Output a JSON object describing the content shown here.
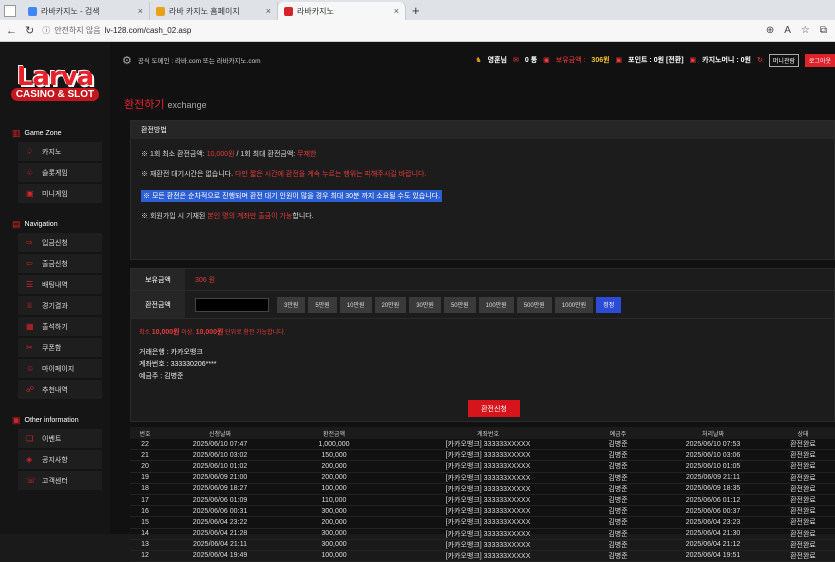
{
  "browser": {
    "tabs": [
      {
        "label": "라바카지노 - 검색",
        "fav": "#4285f4"
      },
      {
        "label": "라바 카지노 홈페이지",
        "fav": "#e8a21a"
      },
      {
        "label": "라바카지노",
        "fav": "#d9232a"
      }
    ],
    "security": "안전하지 않음",
    "url": "lv-128.com/cash_02.asp"
  },
  "site": {
    "logo_main": "Larva",
    "logo_sub": "CASINO & SLOT",
    "domain_note": "공식 도메인 : 라바.com 또는 라바카지노.com",
    "user": "영훈님",
    "msg_count": "0 통",
    "balance_label": "보유금액 :",
    "balance": "306원",
    "points": "포인트 : 0원 [전환]",
    "casino_money": "카지노머니 : 0원",
    "casino_btn": "머니관람",
    "logout": "로그아웃",
    "sections": [
      {
        "title": "Game Zone",
        "items": [
          "카지노",
          "슬롯게임",
          "미니게임"
        ]
      },
      {
        "title": "Navigation",
        "items": [
          "입금신청",
          "출금신청",
          "배팅내역",
          "경기결과",
          "출석하기",
          "쿠폰함",
          "마이페이지",
          "추천내역"
        ]
      },
      {
        "title": "Other information",
        "items": [
          "이벤트",
          "공지사항",
          "고객센터"
        ]
      }
    ],
    "page_title": "환전하기",
    "page_title_en": "exchange",
    "method": {
      "header": "환전방법",
      "line1_a": "※ 1회 최소 환전금액: ",
      "line1_b": "10,000원",
      "line1_c": " / 1회 최대 환전금액: ",
      "line1_d": "무제한",
      "line2_a": "※ 재환전 대기시간은 없습니다. ",
      "line2_b": "다만 짧은 시간에 환전을 계속 누르는 행위는 피해주시길 바랍니다.",
      "line3": "※ 모든 환전은 순차적으로 진행되며 환전 대기 인원이 많을 경우 최대 30분 까지 소요될 수도 있습니다.",
      "line4_a": "※ 회원가입 시 기재된 ",
      "line4_b": "본인 명의 계좌만 출금이 가능",
      "line4_c": "합니다."
    },
    "form": {
      "balance_label": "보유금액",
      "balance_value": "306 원",
      "amount_label": "환전금액",
      "buttons": [
        "3만원",
        "5만원",
        "10만원",
        "20만원",
        "30만원",
        "50만원",
        "100만원",
        "500만원",
        "1000만원",
        "정정"
      ],
      "note_a": "최소 ",
      "note_b": "10,000원",
      "note_c": " 이상, ",
      "note_d": "10,000원",
      "note_e": " 단위로 환전 가능합니다.",
      "bank_line": "거래은행 : 카카오뱅크",
      "account_line": "계좌번호 : 333330206****",
      "holder_line": "예금주 : 김병준",
      "submit": "환전신청"
    },
    "table": {
      "headers": [
        "번호",
        "신청날짜",
        "환전금액",
        "계좌번호",
        "예금주",
        "처리날짜",
        "상태"
      ],
      "rows": [
        [
          "22",
          "2025/06/10 07:47",
          "1,000,000",
          "[카카오뱅크] 333333XXXXX",
          "김병준",
          "2025/06/10 07:53",
          "환전완료"
        ],
        [
          "21",
          "2025/06/10 03:02",
          "150,000",
          "[카카오뱅크] 333333XXXXX",
          "김병준",
          "2025/06/10 03:06",
          "환전완료"
        ],
        [
          "20",
          "2025/06/10 01:02",
          "200,000",
          "[카카오뱅크] 333333XXXXX",
          "김병준",
          "2025/06/10 01:05",
          "환전완료"
        ],
        [
          "19",
          "2025/06/09 21:00",
          "200,000",
          "[카카오뱅크] 333333XXXXX",
          "김병준",
          "2025/06/09 21:11",
          "환전완료"
        ],
        [
          "18",
          "2025/06/09 18:27",
          "100,000",
          "[카카오뱅크] 333333XXXXX",
          "김병준",
          "2025/06/09 18:35",
          "환전완료"
        ],
        [
          "17",
          "2025/06/06 01:09",
          "110,000",
          "[카카오뱅크] 333333XXXXX",
          "김병준",
          "2025/06/06 01:12",
          "환전완료"
        ],
        [
          "16",
          "2025/06/06 00:31",
          "300,000",
          "[카카오뱅크] 333333XXXXX",
          "김병준",
          "2025/06/06 00:37",
          "환전완료"
        ],
        [
          "15",
          "2025/06/04 23:22",
          "200,000",
          "[카카오뱅크] 333333XXXXX",
          "김병준",
          "2025/06/04 23:23",
          "환전완료"
        ],
        [
          "14",
          "2025/06/04 21:28",
          "300,000",
          "[카카오뱅크] 333333XXXXX",
          "김병준",
          "2025/06/04 21:30",
          "환전완료"
        ],
        [
          "13",
          "2025/06/04 21:11",
          "300,000",
          "[카카오뱅크] 333333XXXXX",
          "김병준",
          "2025/06/04 21:12",
          "환전완료"
        ],
        [
          "12",
          "2025/06/04 19:49",
          "100,000",
          "[카카오뱅크] 333333XXXXX",
          "김병준",
          "2025/06/04 19:51",
          "환전완료"
        ]
      ]
    }
  }
}
